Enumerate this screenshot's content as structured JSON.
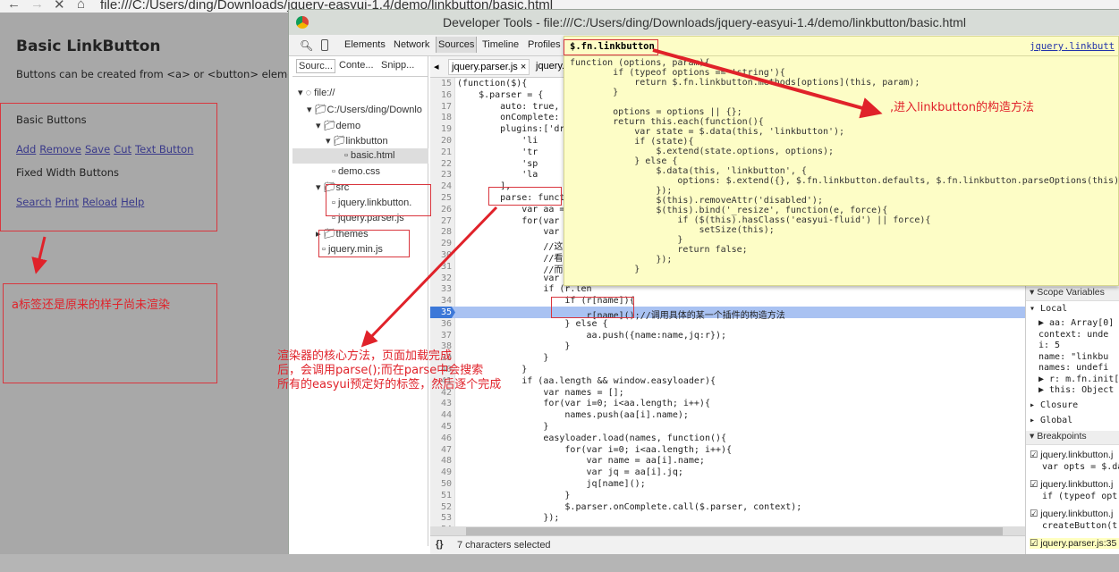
{
  "browser": {
    "url": "file:///C:/Users/ding/Downloads/jquery-easyui-1.4/demo/linkbutton/basic.html"
  },
  "page": {
    "title": "Basic LinkButton",
    "description": "Buttons can be created from <a> or <button> elemer",
    "basic_heading": "Basic Buttons",
    "basic_links": [
      "Add",
      "Remove",
      "Save",
      "Cut",
      "Text Button"
    ],
    "fixed_heading": "Fixed Width Buttons",
    "fixed_links": [
      "Search",
      "Print",
      "Reload",
      "Help"
    ]
  },
  "devtools": {
    "title": "Developer Tools - file:///C:/Users/ding/Downloads/jquery-easyui-1.4/demo/linkbutton/basic.html",
    "tabs": [
      "Elements",
      "Network",
      "Sources",
      "Timeline",
      "Profiles"
    ],
    "active_tab": "Sources",
    "nav_tabs": [
      "Sourc...",
      "Conte...",
      "Snipp..."
    ],
    "tree": [
      "file://",
      "C:/Users/ding/Downlo",
      "demo",
      "linkbutton",
      "basic.html",
      "demo.css",
      "src",
      "jquery.linkbutton.",
      "jquery.parser.js",
      "themes",
      "jquery.min.js"
    ],
    "editor_tabs": [
      "jquery.parser.js ×",
      "jquery."
    ],
    "code": [
      {
        "n": "15",
        "t": "(function($){"
      },
      {
        "n": "16",
        "t": "    $.parser = {"
      },
      {
        "n": "17",
        "t": "        auto: true,"
      },
      {
        "n": "18",
        "t": "        onComplete:"
      },
      {
        "n": "19",
        "t": "        plugins:['dr"
      },
      {
        "n": "20",
        "t": "            'li"
      },
      {
        "n": "21",
        "t": "            'tr"
      },
      {
        "n": "22",
        "t": "            'sp"
      },
      {
        "n": "23",
        "t": "            'la"
      },
      {
        "n": "24",
        "t": "        ],"
      },
      {
        "n": "25",
        "t": "        parse: funct"
      },
      {
        "n": "26",
        "t": "            var aa ="
      },
      {
        "n": "27",
        "t": "            for(var"
      },
      {
        "n": "28",
        "t": "                var"
      },
      {
        "n": "29",
        "t": "                //这"
      },
      {
        "n": "30",
        "t": "                //看"
      },
      {
        "n": "31",
        "t": "                //而"
      },
      {
        "n": "32",
        "t": "                var"
      },
      {
        "n": "33",
        "t": "                if (r.len"
      },
      {
        "n": "34",
        "t": "                    if (r[name]){"
      },
      {
        "n": "35",
        "t": "                        r[name]();//调用具体的某一个插件的构造方法"
      },
      {
        "n": "36",
        "t": "                    } else {"
      },
      {
        "n": "37",
        "t": "                        aa.push({name:name,jq:r});"
      },
      {
        "n": "38",
        "t": "                    }"
      },
      {
        "n": "39",
        "t": "                }"
      },
      {
        "n": "40",
        "t": "            }"
      },
      {
        "n": "41",
        "t": "            if (aa.length && window.easyloader){"
      },
      {
        "n": "42",
        "t": "                var names = [];"
      },
      {
        "n": "43",
        "t": "                for(var i=0; i<aa.length; i++){"
      },
      {
        "n": "44",
        "t": "                    names.push(aa[i].name);"
      },
      {
        "n": "45",
        "t": "                }"
      },
      {
        "n": "46",
        "t": "                easyloader.load(names, function(){"
      },
      {
        "n": "47",
        "t": "                    for(var i=0; i<aa.length; i++){"
      },
      {
        "n": "48",
        "t": "                        var name = aa[i].name;"
      },
      {
        "n": "49",
        "t": "                        var jq = aa[i].jq;"
      },
      {
        "n": "50",
        "t": "                        jq[name]();"
      },
      {
        "n": "51",
        "t": "                    }"
      },
      {
        "n": "52",
        "t": "                    $.parser.onComplete.call($.parser, context);"
      },
      {
        "n": "53",
        "t": "                });"
      },
      {
        "n": "54",
        "t": ""
      }
    ],
    "current_line": "35",
    "status": "7 characters selected",
    "popover": {
      "title": "$.fn.linkbutton",
      "link": "jquery.linkbutt",
      "code": "function (options, param){\n        if (typeof options == 'string'){\n            return $.fn.linkbutton.methods[options](this, param);\n        }\n\n        options = options || {};\n        return this.each(function(){\n            var state = $.data(this, 'linkbutton');\n            if (state){\n                $.extend(state.options, options);\n            } else {\n                $.data(this, 'linkbutton', {\n                    options: $.extend({}, $.fn.linkbutton.defaults, $.fn.linkbutton.parseOptions(this)\n                });\n                $(this).removeAttr('disabled');\n                $(this).bind('_resize', function(e, force){\n                    if ($(this).hasClass('easyui-fluid') || force){\n                        setSize(this);\n                    }\n                    return false;\n                });\n            }"
    },
    "sidebar": {
      "scope": "Scope Variables",
      "local": "Local",
      "vars": [
        "▶ aa: Array[0]",
        "  context: unde",
        "  i: 5",
        "  name: \"linkbu",
        "  names: undefi",
        "▶ r: m.fn.init[",
        "▶ this: Object"
      ],
      "closure": "Closure",
      "global": "Global",
      "breakpoints": "Breakpoints",
      "bps": [
        {
          "file": "jquery.linkbutton.j",
          "code": "var opts = $.da"
        },
        {
          "file": "jquery.linkbutton.j",
          "code": "if (typeof opt"
        },
        {
          "file": "jquery.linkbutton.j",
          "code": "createButton(t"
        },
        {
          "file": "jquery.parser.js:35",
          "code": ""
        }
      ]
    }
  },
  "annotations": {
    "popover_note": ",进入linkbutton的构造方法",
    "left_note": "a标签还是原来的样子尚未渲染",
    "parse_note": "渲染器的核心方法，页面加载完成\n后，会调用parse();而在parse中会搜索\n所有的easyui预定好的标签，然后逐个完成"
  },
  "colors": {
    "annotation": "#e0222a",
    "highlight": "#a9c2f2",
    "popover": "#fdfdc6"
  }
}
